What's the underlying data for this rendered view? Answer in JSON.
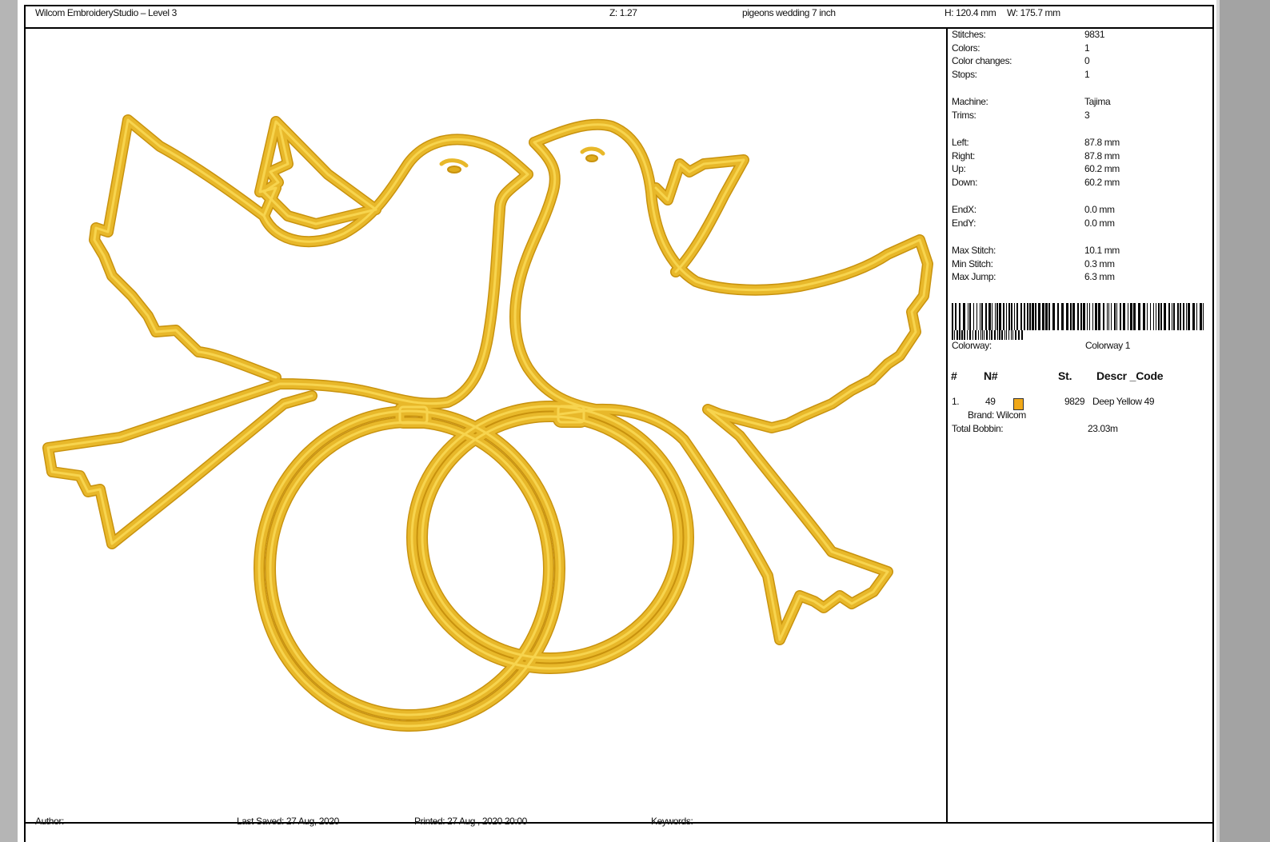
{
  "header": {
    "app_title": "Wilcom EmbroideryStudio – Level 3",
    "zoom": "Z: 1.27",
    "design_name": "pigeons wedding 7 inch",
    "height": "H: 120.4 mm",
    "width": "W: 175.7 mm"
  },
  "design": {
    "thread_color": "#e8b82a",
    "shade_color": "#c8920e",
    "icon": "two-doves-wedding-rings-icon"
  },
  "stats": [
    {
      "label": "Stitches:",
      "value": "9831"
    },
    {
      "label": "Colors:",
      "value": "1"
    },
    {
      "label": "Color changes:",
      "value": "0"
    },
    {
      "label": "Stops:",
      "value": "1"
    },
    {
      "label": "Machine:",
      "value": "Tajima"
    },
    {
      "label": "Trims:",
      "value": "3"
    },
    {
      "label": "Left:",
      "value": "87.8 mm"
    },
    {
      "label": "Right:",
      "value": "87.8 mm"
    },
    {
      "label": "Up:",
      "value": "60.2 mm"
    },
    {
      "label": "Down:",
      "value": "60.2 mm"
    },
    {
      "label": "EndX:",
      "value": "0.0 mm"
    },
    {
      "label": "EndY:",
      "value": "0.0 mm"
    },
    {
      "label": "Max Stitch:",
      "value": "10.1 mm"
    },
    {
      "label": "Min Stitch:",
      "value": "0.3 mm"
    },
    {
      "label": "Max Jump:",
      "value": "6.3 mm"
    }
  ],
  "colorway": {
    "label": "Colorway:",
    "value": "Colorway 1"
  },
  "color_table": {
    "headers": {
      "num": "#",
      "n": "N#",
      "st": "St.",
      "descr": "Descr _Code"
    },
    "row": {
      "num": "1.",
      "n": "49",
      "st": "9829",
      "descr": "Deep Yellow 49",
      "swatch": "#f0a818"
    },
    "brand": "Brand: Wilcom"
  },
  "bobbin": {
    "label": "Total Bobbin:",
    "value": "23.03m"
  },
  "footer": {
    "author": "Author:",
    "last_saved": "Last Saved: 27 Aug, 2020",
    "printed": "Printed: 27 Aug , 2020 20:00",
    "keywords": "Keywords:"
  }
}
